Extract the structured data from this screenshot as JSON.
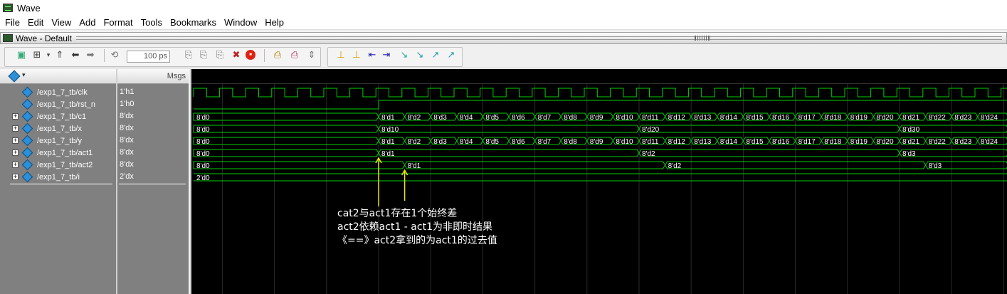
{
  "window": {
    "title": "Wave"
  },
  "menu": [
    "File",
    "Edit",
    "View",
    "Add",
    "Format",
    "Tools",
    "Bookmarks",
    "Window",
    "Help"
  ],
  "pane": {
    "title": "Wave - Default"
  },
  "toolbar": {
    "time_value": "100 ps"
  },
  "headers": {
    "msgs": "Msgs"
  },
  "signals": [
    {
      "name": "/exp1_7_tb/clk",
      "value": "1'h1",
      "expandable": false
    },
    {
      "name": "/exp1_7_tb/rst_n",
      "value": "1'h0",
      "expandable": false
    },
    {
      "name": "/exp1_7_tb/c1",
      "value": "8'dx",
      "expandable": true
    },
    {
      "name": "/exp1_7_tb/x",
      "value": "8'dx",
      "expandable": true
    },
    {
      "name": "/exp1_7_tb/y",
      "value": "8'dx",
      "expandable": true
    },
    {
      "name": "/exp1_7_tb/act1",
      "value": "8'dx",
      "expandable": true
    },
    {
      "name": "/exp1_7_tb/act2",
      "value": "8'dx",
      "expandable": true
    },
    {
      "name": "/exp1_7_tb/i",
      "value": "2'dx",
      "expandable": true
    }
  ],
  "waves": {
    "c1": {
      "initial": "8'd0",
      "labels": [
        "8'd1",
        "8'd2",
        "8'd3",
        "8'd4",
        "8'd5",
        "8'd6",
        "8'd7",
        "8'd8",
        "8'd9",
        "8'd10",
        "8'd11",
        "8'd12",
        "8'd13",
        "8'd14",
        "8'd15",
        "8'd16",
        "8'd17",
        "8'd18",
        "8'd19",
        "8'd20",
        "8'd21",
        "8'd22",
        "8'd23",
        "8'd24"
      ]
    },
    "x": {
      "initial": "8'd0",
      "labels": [
        "8'd10",
        "8'd20",
        "8'd30"
      ]
    },
    "y": {
      "initial": "8'd0",
      "labels": [
        "8'd1",
        "8'd2",
        "8'd3",
        "8'd4",
        "8'd5",
        "8'd6",
        "8'd7",
        "8'd8",
        "8'd9",
        "8'd10",
        "8'd11",
        "8'd12",
        "8'd13",
        "8'd14",
        "8'd15",
        "8'd16",
        "8'd17",
        "8'd18",
        "8'd19",
        "8'd20",
        "8'd21",
        "8'd22",
        "8'd23",
        "8'd24"
      ]
    },
    "act1": {
      "initial": "8'd0",
      "labels": [
        "8'd1",
        "8'd2",
        "8'd3"
      ]
    },
    "act2": {
      "initial": "8'd0",
      "labels": [
        "8'd1",
        "8'd2",
        "8'd3"
      ]
    },
    "i": {
      "initial": "2'd0",
      "labels": []
    }
  },
  "annotation": {
    "lines": [
      "cat2与act1存在1个始终差",
      "act2依赖act1 - act1为非即时结果",
      "《==》act2拿到的为act1的过去值"
    ]
  },
  "colors": {
    "wave": "#00d000",
    "cursor": "#e8e800",
    "background": "#000000",
    "annotation": "#ffffff"
  }
}
